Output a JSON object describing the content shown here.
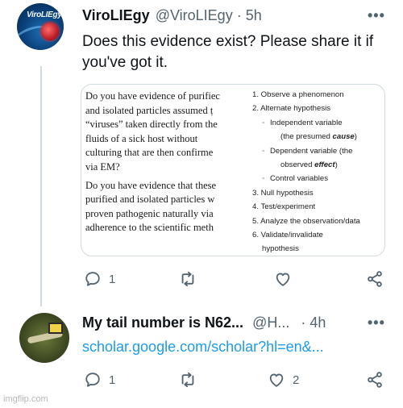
{
  "tweet1": {
    "display_name": "ViroLIEgy",
    "handle": "@ViroLIEgy",
    "separator": "·",
    "time": "5h",
    "more": "•••",
    "avatar_text": "ViroLIEgy",
    "text_lines": [
      "Does this evidence exist? Please share it if",
      "you've got it."
    ],
    "media": {
      "left_para1": [
        "Do you have evidence of purifiec",
        "and isolated particles assumed ṭ",
        "“viruses” taken directly from the",
        "fluids of a sick host without",
        "culturing that are then confirme",
        "via EM?"
      ],
      "left_para2": [
        "Do you have evidence that these",
        "purified and isolated particles w",
        "proven pathogenic naturally via",
        "adherence to the scientific meth"
      ],
      "right_items": [
        {
          "text": "1. Observe a phenomenon",
          "kind": "main"
        },
        {
          "text": "2. Alternate hypothesis",
          "kind": "main"
        },
        {
          "text": "Independent variable",
          "kind": "sub"
        },
        {
          "text": "(the presumed ",
          "emph": "cause",
          "after": ")",
          "kind": "cont"
        },
        {
          "text": "Dependent variable (the",
          "kind": "sub"
        },
        {
          "text": "observed ",
          "emph": "effect",
          "after": ")",
          "kind": "cont"
        },
        {
          "text": "Control variables",
          "kind": "sub"
        },
        {
          "text": "3. Null hypothesis",
          "kind": "main"
        },
        {
          "text": "4. Test/experiment",
          "kind": "main"
        },
        {
          "text": "5. Analyze the observation/data",
          "kind": "main"
        },
        {
          "text": "6. Validate/invalidate",
          "kind": "main"
        },
        {
          "text": "hypothesis",
          "kind": "wrap"
        }
      ]
    },
    "actions": {
      "reply_count": "1",
      "retweet_count": "",
      "like_count": ""
    }
  },
  "tweet2": {
    "display_name": "My tail number is N62...",
    "handle": "@H...",
    "separator": "·",
    "time": "4h",
    "more": "•••",
    "link": "scholar.google.com/scholar?hl=en&...",
    "actions": {
      "reply_count": "1",
      "retweet_count": "",
      "like_count": "2"
    }
  },
  "watermark": "imgflip.com",
  "colors": {
    "link": "#1d9bf0",
    "muted": "#536471",
    "text": "#0f1419",
    "border": "#cfd9de"
  }
}
